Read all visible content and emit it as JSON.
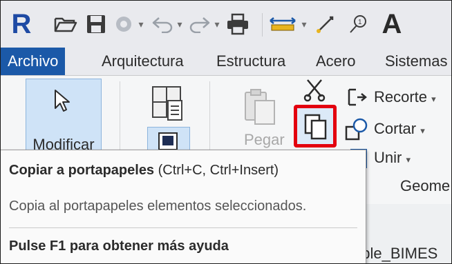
{
  "app": {
    "logo_letter": "R"
  },
  "tabs": [
    {
      "label": "Archivo",
      "active": true
    },
    {
      "label": "Arquitectura"
    },
    {
      "label": "Estructura"
    },
    {
      "label": "Acero"
    },
    {
      "label": "Sistemas"
    }
  ],
  "ribbon": {
    "modify_label": "Modificar",
    "paste_label": "Pegar",
    "recorte_label": "Recorte",
    "cortar_label": "Cortar",
    "unir_label": "Unir",
    "panel_label": "Geome"
  },
  "tooltip": {
    "title_bold": "Copiar a portapapeles",
    "title_shortcut": " (Ctrl+C, Ctrl+Insert)",
    "description": "Copia al portapapeles elementos seleccionados.",
    "help": "Pulse F1 para obtener más ayuda"
  },
  "below": {
    "partial_text": "able_BIMES"
  },
  "colors": {
    "accent": "#1b59a8",
    "highlight": "#e3000f"
  }
}
